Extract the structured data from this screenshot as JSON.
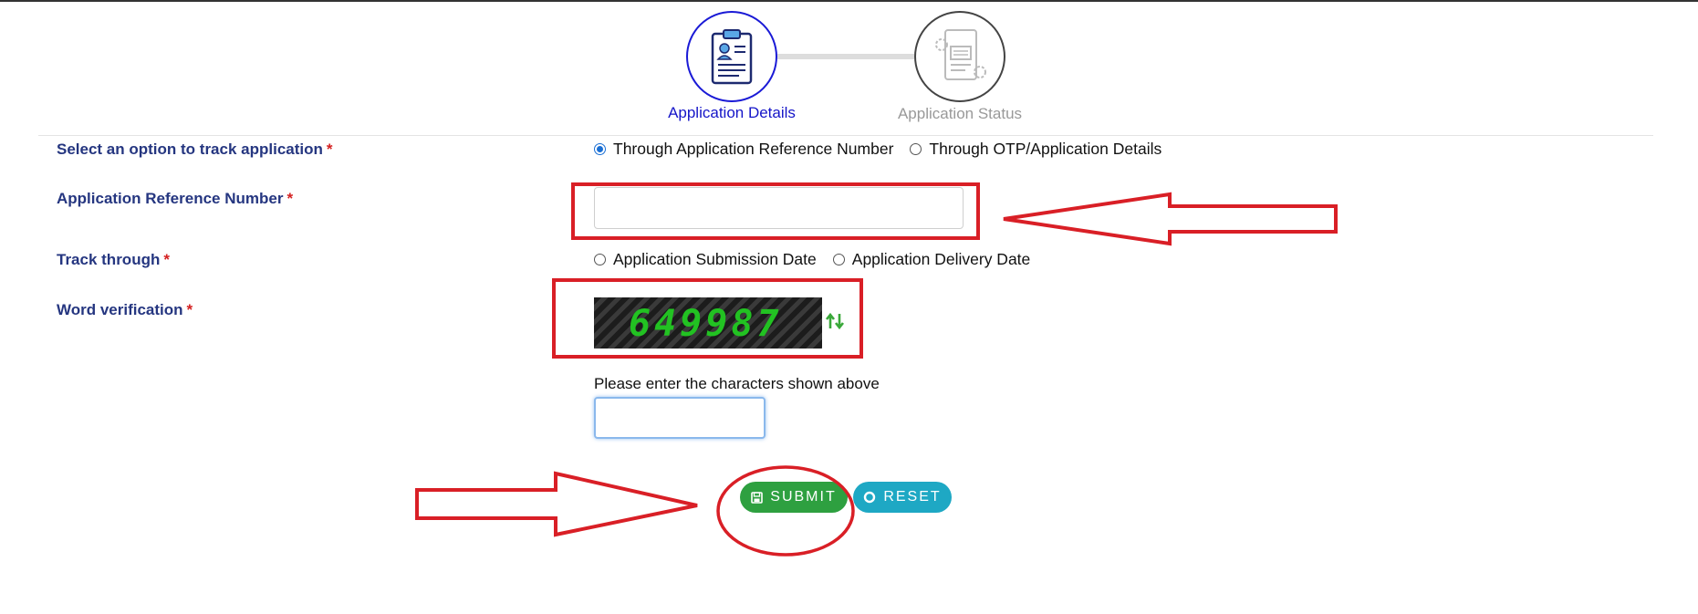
{
  "stepper": {
    "steps": [
      {
        "label": "Application Details",
        "state": "active",
        "icon": "clipboard-profile-icon"
      },
      {
        "label": "Application Status",
        "state": "inactive",
        "icon": "document-gears-icon"
      }
    ]
  },
  "form": {
    "track_option": {
      "label": "Select an option to track application",
      "required_mark": "*",
      "options": [
        "Through Application Reference Number",
        "Through OTP/Application Details"
      ],
      "selected": "Through Application Reference Number"
    },
    "reference_number": {
      "label": "Application Reference Number",
      "required_mark": "*",
      "value": ""
    },
    "track_through": {
      "label": "Track through",
      "required_mark": "*",
      "options": [
        "Application Submission Date",
        "Application Delivery Date"
      ]
    },
    "word_verification": {
      "label": "Word verification",
      "required_mark": "*",
      "captcha_text": "649987",
      "refresh_icon": "refresh-icon",
      "hint": "Please enter the characters shown above",
      "value": ""
    }
  },
  "actions": {
    "submit_label": "SUBMIT",
    "reset_label": "RESET"
  },
  "colors": {
    "active_step": "#1515c8",
    "label": "#253680",
    "required": "#d42020",
    "submit": "#2ea040",
    "reset": "#1ea8c4",
    "annotation": "#d91f26"
  }
}
